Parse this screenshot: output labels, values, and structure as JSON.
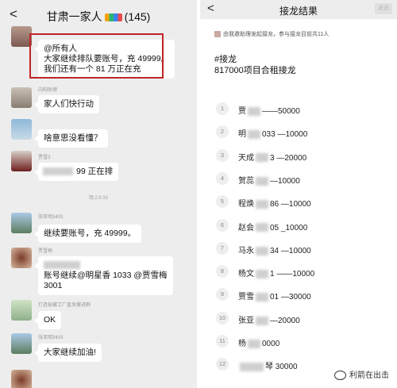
{
  "left": {
    "header": {
      "title": "甘肃一家人",
      "count": "(145)"
    },
    "timestamp": "晚上8:38",
    "messages": [
      {
        "sender": "",
        "lines": [
          "@所有人",
          "大家继续排队要账号，充 49999。",
          "我们还有一个 81 万正在充"
        ]
      },
      {
        "sender": "向阳助理",
        "lines": [
          "家人们快行动"
        ]
      },
      {
        "sender": "",
        "lines": [
          "啥意思没看懂？"
        ]
      },
      {
        "sender": "贾雪3",
        "lines": [
          "99 正在排"
        ]
      },
      {
        "sender": "张亚明3403",
        "lines": [
          "继续要账号，充 49999。"
        ]
      },
      {
        "sender": "贾雪梅",
        "lines": [
          "账号继续@明星香 1033 @贾雪梅",
          "3001"
        ]
      },
      {
        "sender": "打造秘藏工厂直发撤进群",
        "lines": [
          "OK"
        ]
      },
      {
        "sender": "张亚明3403",
        "lines": [
          "大家继续加油!"
        ]
      }
    ]
  },
  "right": {
    "header": {
      "back": "<",
      "title": "接龙结果",
      "send_label": "发送"
    },
    "info": "由我邀助理发起接龙，参与接龙目前共11人",
    "jielong_tag": "#接龙",
    "jielong_title": "817000项目合租接龙",
    "entries": [
      {
        "num": "1",
        "name": "贾",
        "amount": "——50000"
      },
      {
        "num": "2",
        "name": "明",
        "amount": "033 —10000"
      },
      {
        "num": "3",
        "name": "天成",
        "amount": "3 —20000"
      },
      {
        "num": "4",
        "name": "贺蕊",
        "amount": "—10000"
      },
      {
        "num": "5",
        "name": "程焕",
        "amount": "86 —10000"
      },
      {
        "num": "6",
        "name": "赵会",
        "amount": "05 _10000"
      },
      {
        "num": "7",
        "name": "马永",
        "amount": "34 —10000"
      },
      {
        "num": "8",
        "name": "杨文",
        "amount": "1 ——10000"
      },
      {
        "num": "9",
        "name": "贾雪",
        "amount": "01 —30000"
      },
      {
        "num": "10",
        "name": "张亚",
        "amount": "—20000"
      },
      {
        "num": "11",
        "name": "杨",
        "amount": "0000"
      },
      {
        "num": "12",
        "name": "",
        "amount": "琴 30000"
      }
    ],
    "watermark": "利箭在出击"
  }
}
